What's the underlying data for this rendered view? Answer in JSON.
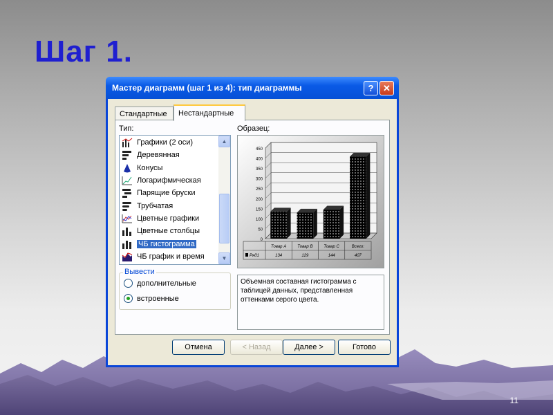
{
  "slide": {
    "title": "Шаг 1.",
    "page_number": "11"
  },
  "dialog": {
    "title": "Мастер диаграмм (шаг 1 из 4): тип диаграммы",
    "help_button": "?",
    "close_button": "✕",
    "tabs": [
      {
        "label": "Стандартные",
        "active": false
      },
      {
        "label": "Нестандартные",
        "active": true
      }
    ],
    "type_label": "Тип:",
    "sample_label": "Образец:",
    "chart_types": [
      {
        "label": "Графики (2 оси)",
        "icon": "two-axis-chart-icon"
      },
      {
        "label": "Деревянная",
        "icon": "wooden-bars-icon"
      },
      {
        "label": "Конусы",
        "icon": "cone-icon"
      },
      {
        "label": "Логарифмическая",
        "icon": "log-chart-icon"
      },
      {
        "label": "Парящие бруски",
        "icon": "floating-bars-icon"
      },
      {
        "label": "Трубчатая",
        "icon": "tube-bars-icon"
      },
      {
        "label": "Цветные графики",
        "icon": "colored-lines-icon"
      },
      {
        "label": "Цветные столбцы",
        "icon": "colored-columns-icon"
      },
      {
        "label": "ЧБ гистограмма",
        "icon": "bw-histogram-icon",
        "selected": true
      },
      {
        "label": "ЧБ график и время",
        "icon": "bw-line-time-icon"
      }
    ],
    "output_group": {
      "label": "Вывести",
      "options": [
        {
          "label": "дополнительные",
          "checked": false
        },
        {
          "label": "встроенные",
          "checked": true
        }
      ]
    },
    "description": "Объемная составная гистограмма с таблицей данных, представленная оттенками серого цвета.",
    "buttons": {
      "cancel": "Отмена",
      "back": "< Назад",
      "next": "Далее >",
      "finish": "Готово"
    }
  },
  "chart_data": {
    "type": "bar",
    "categories": [
      "Товар A",
      "Товар B",
      "Товар C",
      "Всего:"
    ],
    "series": [
      {
        "name": "Ряд1",
        "values": [
          134,
          129,
          144,
          407
        ]
      }
    ],
    "ylim": [
      0,
      450
    ],
    "y_ticks": [
      "0",
      "50",
      "100",
      "150",
      "200",
      "250",
      "300",
      "350",
      "400",
      "450"
    ],
    "table_row_label": "Ряд1",
    "colors": {
      "bar": "#000000",
      "dots": "#ffffff"
    },
    "grid": true
  }
}
